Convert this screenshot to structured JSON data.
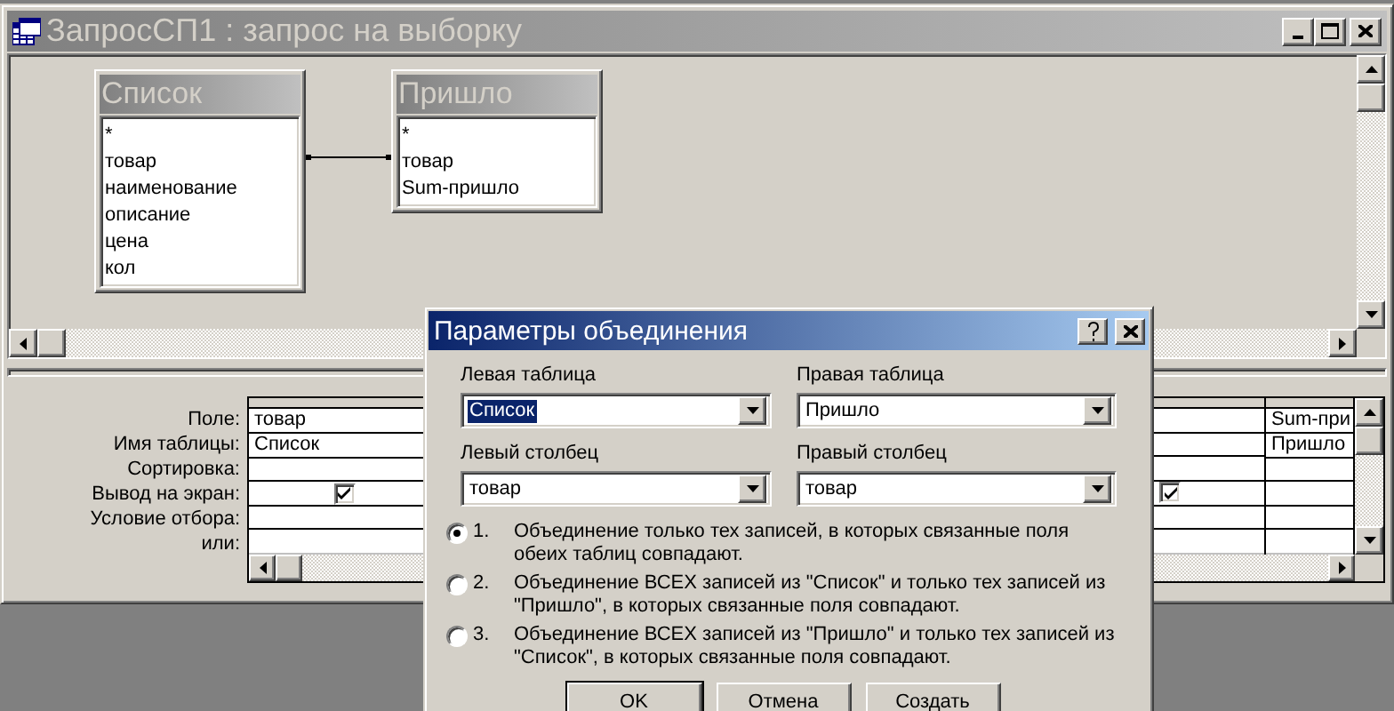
{
  "window": {
    "title": "ЗапросСП1 : запрос на выборку"
  },
  "field_lists": [
    {
      "title": "Список",
      "fields": [
        "*",
        "товар",
        "наименование",
        "описание",
        "цена",
        "кол"
      ]
    },
    {
      "title": "Пришло",
      "fields": [
        "*",
        "товар",
        "Sum-пришло"
      ]
    }
  ],
  "grid": {
    "row_labels": [
      "Поле:",
      "Имя таблицы:",
      "Сортировка:",
      "Вывод на экран:",
      "Условие отбора:",
      "или:"
    ],
    "columns": [
      {
        "field": "товар",
        "table": "Список",
        "show": true
      },
      {
        "show": true
      },
      {
        "field": "Sum-при",
        "table": "Пришло"
      }
    ]
  },
  "dialog": {
    "title": "Параметры объединения",
    "combos": [
      {
        "label": "Левая таблица",
        "value": "Список",
        "focused": true
      },
      {
        "label": "Правая таблица",
        "value": "Пришло",
        "focused": false
      },
      {
        "label": "Левый столбец",
        "value": "товар",
        "focused": false
      },
      {
        "label": "Правый столбец",
        "value": "товар",
        "focused": false
      }
    ],
    "options": [
      {
        "number": "1.",
        "text": "Объединение только тех записей, в которых связанные поля обеих таблиц совпадают.",
        "selected": true
      },
      {
        "number": "2.",
        "text": "Объединение ВСЕХ записей из \"Список\" и только тех записей из \"Пришло\", в которых связанные поля совпадают.",
        "selected": false
      },
      {
        "number": "3.",
        "text": "Объединение ВСЕХ записей из \"Пришло\" и только тех записей из \"Список\", в которых связанные поля совпадают.",
        "selected": false
      }
    ],
    "buttons": [
      "OK",
      "Отмена",
      "Создать"
    ]
  }
}
